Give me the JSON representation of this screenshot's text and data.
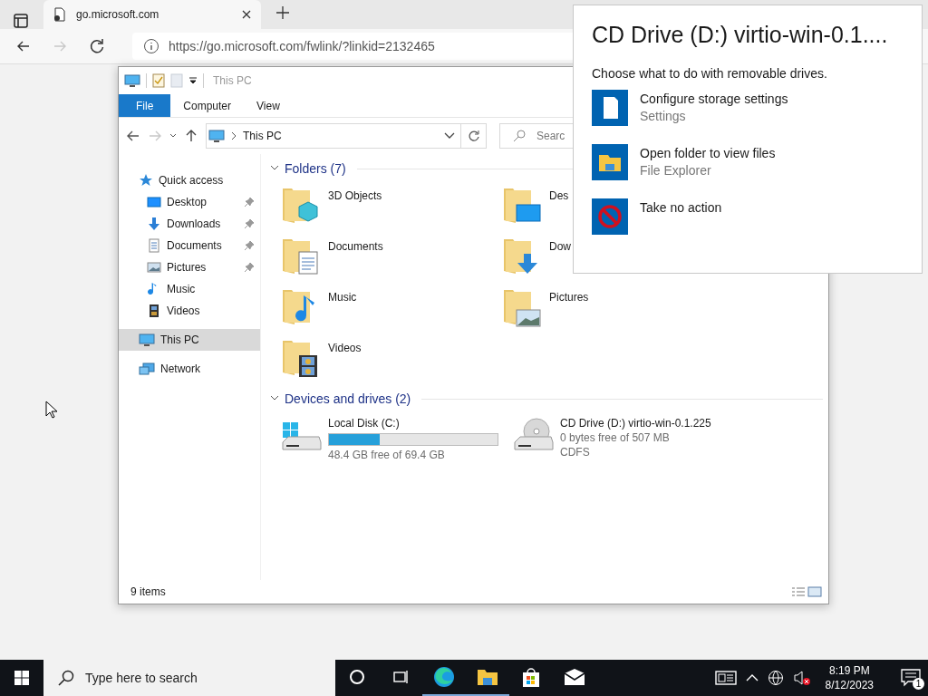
{
  "browser": {
    "tabs": [
      {
        "title": "go.microsoft.com",
        "selected": true
      }
    ],
    "forward_disabled": true,
    "url": "https://go.microsoft.com/fwlink/?linkid=2132465"
  },
  "explorer": {
    "title": "This PC",
    "ribbon_tabs": [
      {
        "label": "File",
        "kind": "menu"
      },
      {
        "label": "Computer",
        "kind": "tab"
      },
      {
        "label": "View",
        "kind": "tab"
      }
    ],
    "forward_disabled": true,
    "address": "This PC",
    "search": {
      "placeholder": "Searc"
    },
    "nav": [
      {
        "label": "Quick access",
        "kind": "star",
        "selected": false,
        "children": [
          {
            "label": "Desktop",
            "kind": "desktop",
            "pinned": true,
            "selected": false
          },
          {
            "label": "Downloads",
            "kind": "downloads",
            "pinned": true,
            "selected": false
          },
          {
            "label": "Documents",
            "kind": "documents",
            "pinned": true,
            "selected": false
          },
          {
            "label": "Pictures",
            "kind": "pictures",
            "pinned": true,
            "selected": false
          },
          {
            "label": "Music",
            "kind": "music",
            "pinned": false,
            "selected": false
          },
          {
            "label": "Videos",
            "kind": "videos",
            "pinned": false,
            "selected": false
          }
        ]
      },
      {
        "label": "This PC",
        "kind": "pc",
        "selected": true
      },
      {
        "label": "Network",
        "kind": "network",
        "selected": false
      }
    ],
    "sections": [
      {
        "title": "Folders (7)",
        "kind": "folders",
        "items": [
          {
            "label": "3D Objects",
            "kind": "objects"
          },
          {
            "label": "Des",
            "kind": "desktop"
          },
          {
            "label": "Documents",
            "kind": "documents"
          },
          {
            "label": "Dow",
            "kind": "downloads"
          },
          {
            "label": "Music",
            "kind": "music"
          },
          {
            "label": "Pictures",
            "kind": "pictures"
          },
          {
            "label": "Videos",
            "kind": "videos"
          }
        ]
      },
      {
        "title": "Devices and drives (2)",
        "kind": "drives",
        "items": [
          {
            "label": "Local Disk (C:)",
            "kind": "disk",
            "level": 0.3,
            "detail": "48.4 GB free of 69.4 GB"
          },
          {
            "label": "CD Drive (D:) virtio-win-0.1.225",
            "kind": "cd",
            "detail": "0 bytes free of 507 MB",
            "filesystem": "CDFS"
          }
        ]
      }
    ],
    "status": "9 items"
  },
  "autoplay": {
    "title": "CD Drive (D:) virtio-win-0.1....",
    "prompt": "Choose what to do with removable drives.",
    "options": [
      {
        "label": "Configure storage settings",
        "detail": "Settings",
        "kind": "storage"
      },
      {
        "label": "Open folder to view files",
        "detail": "File Explorer",
        "kind": "folder"
      },
      {
        "label": "Take no action",
        "kind": "none"
      }
    ]
  },
  "taskbar": {
    "search": {
      "placeholder": "Type here to search"
    },
    "apps": [
      {
        "kind": "cortana",
        "running": false
      },
      {
        "kind": "taskview",
        "running": false
      },
      {
        "kind": "edge",
        "running": true
      },
      {
        "kind": "explorer",
        "running": true
      },
      {
        "kind": "store",
        "running": false
      },
      {
        "kind": "mail",
        "running": false
      }
    ],
    "time": "8:19 PM",
    "date": "8/12/2023",
    "notifications": "1"
  }
}
